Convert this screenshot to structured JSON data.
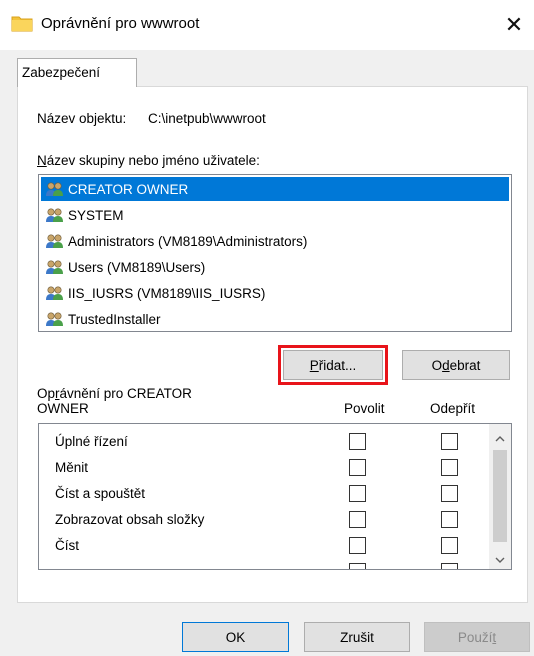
{
  "window": {
    "title": "Oprávnění pro wwwroot",
    "close_symbol": "✕",
    "icon": "folder-icon"
  },
  "tabs": [
    {
      "label": "Zabezpečení",
      "active": true
    }
  ],
  "object": {
    "label": "Název objektu:",
    "value": "C:\\inetpub\\wwwroot"
  },
  "groups": {
    "label_underlined": "N",
    "label_rest": "ázev skupiny nebo jméno uživatele:",
    "items": [
      {
        "name": "CREATOR OWNER",
        "selected": true
      },
      {
        "name": "SYSTEM",
        "selected": false
      },
      {
        "name": "Administrators (VM8189\\Administrators)",
        "selected": false
      },
      {
        "name": "Users (VM8189\\Users)",
        "selected": false
      },
      {
        "name": "IIS_IUSRS (VM8189\\IIS_IUSRS)",
        "selected": false
      },
      {
        "name": "TrustedInstaller",
        "selected": false
      }
    ],
    "icon": "users-icon"
  },
  "buttons": {
    "add_ul": "P",
    "add_rest": "řidat...",
    "remove_pre": "O",
    "remove_ul": "d",
    "remove_rest": "ebrat",
    "ok": "OK",
    "cancel": "Zrušit",
    "apply_pre": "Použí",
    "apply_ul": "t"
  },
  "permissions": {
    "title_line1_pre": "Op",
    "title_line1_ul": "r",
    "title_line1_rest": "ávnění pro CREATOR",
    "title_line2": "OWNER",
    "allow_header": "Povolit",
    "deny_header": "Odepřít",
    "rows": [
      {
        "name": "Úplné řízení",
        "allow": false,
        "deny": false
      },
      {
        "name": "Měnit",
        "allow": false,
        "deny": false
      },
      {
        "name": "Číst a spouštět",
        "allow": false,
        "deny": false
      },
      {
        "name": "Zobrazovat obsah složky",
        "allow": false,
        "deny": false
      },
      {
        "name": "Číst",
        "allow": false,
        "deny": false
      }
    ]
  },
  "colors": {
    "selection": "#0078d7",
    "highlight_frame": "#e8141a",
    "dialog_bg": "#f0f0f0"
  }
}
